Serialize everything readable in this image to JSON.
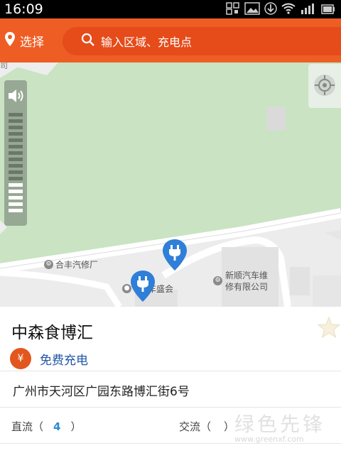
{
  "status_bar": {
    "time": "16:09"
  },
  "header": {
    "location_label": "选择",
    "search_placeholder": "输入区域、充电点"
  },
  "map": {
    "pois": [
      {
        "name": "合丰汽修厂"
      },
      {
        "name": "车盛会"
      },
      {
        "line1": "新顺汽车维",
        "line2": "修有限公司"
      }
    ],
    "edge_text": "司"
  },
  "station": {
    "name": "中森食博汇",
    "fee_icon": "¥",
    "fee_label": "免费充电",
    "address": "广州市天河区广园东路博汇街6号",
    "dc_label": "直流（",
    "dc_count": "4",
    "dc_close": "）",
    "ac_label": "交流（",
    "ac_close": "）"
  },
  "watermark": {
    "text": "绿色先锋",
    "url": "www.greenxf.com"
  },
  "colors": {
    "accent": "#ee5e24",
    "link": "#1e56a8",
    "marker": "#2f7fd8"
  }
}
